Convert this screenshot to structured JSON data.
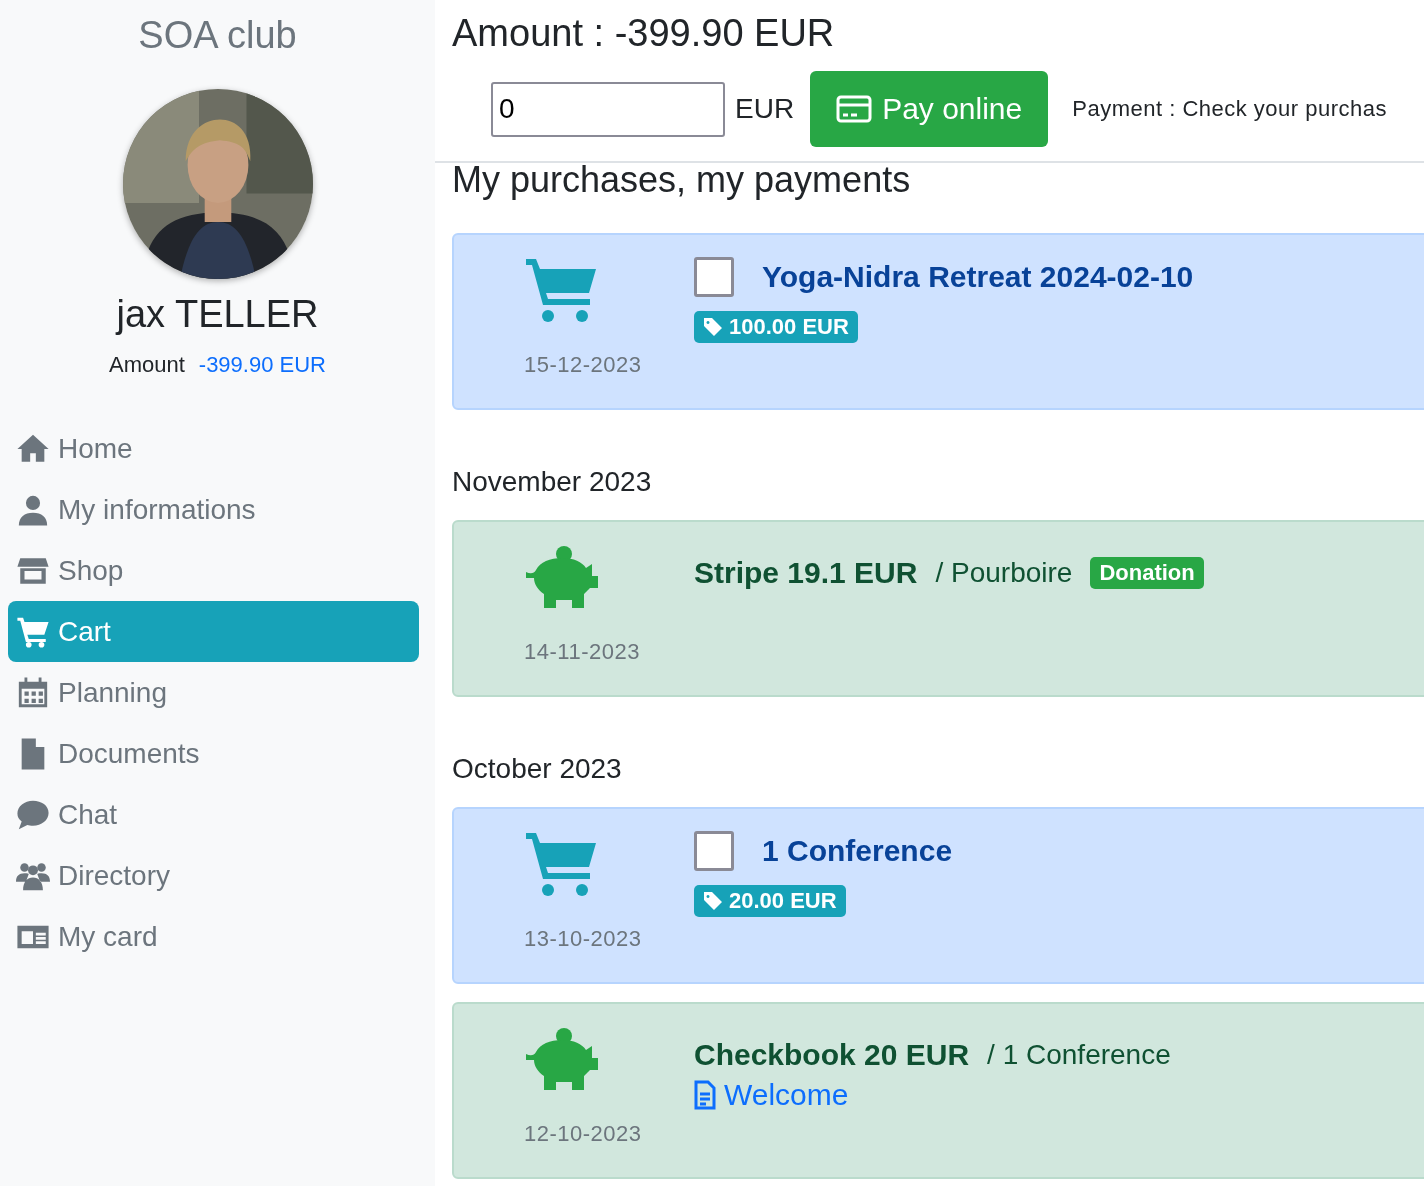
{
  "sidebar": {
    "brand": "SOA club",
    "user_name": "jax TELLER",
    "amount_label": "Amount",
    "amount_value": "-399.90 EUR",
    "nav": [
      {
        "label": "Home",
        "selected": false
      },
      {
        "label": "My informations",
        "selected": false
      },
      {
        "label": "Shop",
        "selected": false
      },
      {
        "label": "Cart",
        "selected": true
      },
      {
        "label": "Planning",
        "selected": false
      },
      {
        "label": "Documents",
        "selected": false
      },
      {
        "label": "Chat",
        "selected": false
      },
      {
        "label": "Directory",
        "selected": false
      },
      {
        "label": "My card",
        "selected": false
      }
    ]
  },
  "header": {
    "amount_title": "Amount : -399.90 EUR",
    "pay_field": {
      "value": "0"
    },
    "currency": "EUR",
    "pay_button": "Pay online",
    "note": "Payment : Check your purchas"
  },
  "section_title": "My purchases, my payments",
  "groups": [
    {
      "entries": [
        {
          "kind": "purchase",
          "date": "15-12-2023",
          "checked": false,
          "title": "Yoga-Nidra Retreat 2024-02-10",
          "price": "100.00 EUR"
        }
      ]
    },
    {
      "heading": "November 2023",
      "entries": [
        {
          "kind": "payment",
          "date": "14-11-2023",
          "title": "Stripe 19.1 EUR",
          "detail": "/ Pourboire",
          "tag": "Donation"
        }
      ]
    },
    {
      "heading": "October 2023",
      "entries": [
        {
          "kind": "purchase",
          "date": "13-10-2023",
          "checked": false,
          "title": "1 Conference",
          "price": "20.00 EUR"
        },
        {
          "kind": "payment",
          "date": "12-10-2023",
          "title": "Checkbook 20 EUR",
          "detail": "/ 1 Conference",
          "link": "Welcome"
        }
      ]
    }
  ]
}
